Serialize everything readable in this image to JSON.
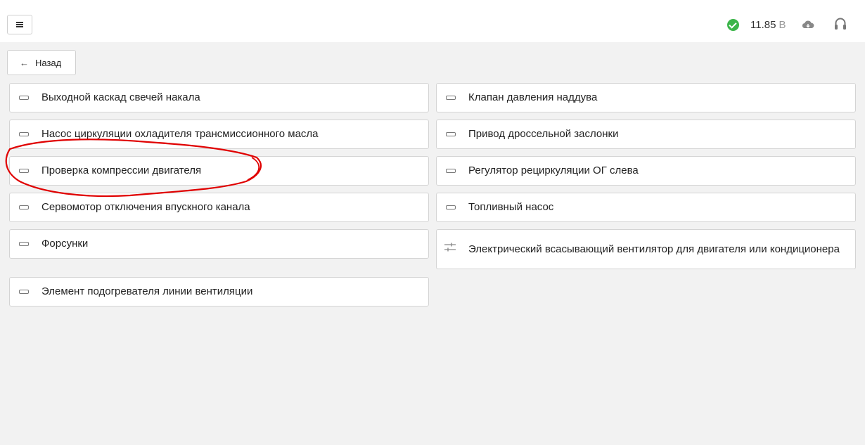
{
  "toolbar": {
    "menu_icon": "menu-icon",
    "status": {
      "ok_icon": "check-circle-icon",
      "ok_color": "#3cb54a",
      "voltage_value": "11.85",
      "voltage_unit": "В",
      "cloud_icon": "cloud-icon",
      "support_icon": "headset-icon"
    }
  },
  "back_button": {
    "arrow": "←",
    "label": "Назад"
  },
  "items_left": [
    {
      "label": "Выходной каскад свечей накала",
      "icon": "rectangle-icon"
    },
    {
      "label": "Насос циркуляции охладителя трансмиссионного масла",
      "icon": "rectangle-icon"
    },
    {
      "label": "Проверка компрессии двигателя",
      "icon": "rectangle-icon",
      "highlighted": true
    },
    {
      "label": "Сервомотор отключения впускного канала",
      "icon": "rectangle-icon"
    },
    {
      "label": "Форсунки",
      "icon": "rectangle-icon"
    },
    {
      "label": "Элемент подогревателя линии вентиляции",
      "icon": "rectangle-icon"
    }
  ],
  "items_right": [
    {
      "label": "Клапан давления наддува",
      "icon": "rectangle-icon"
    },
    {
      "label": "Привод дроссельной заслонки",
      "icon": "rectangle-icon"
    },
    {
      "label": "Регулятор рециркуляции ОГ слева",
      "icon": "rectangle-icon"
    },
    {
      "label": "Топливный насос",
      "icon": "rectangle-icon"
    },
    {
      "label": "Электрический всасывающий вентилятор для двигателя или кондиционера",
      "icon": "sliders-icon"
    }
  ],
  "annotation": {
    "color": "#e00000",
    "shape": "hand-drawn-ellipse"
  }
}
